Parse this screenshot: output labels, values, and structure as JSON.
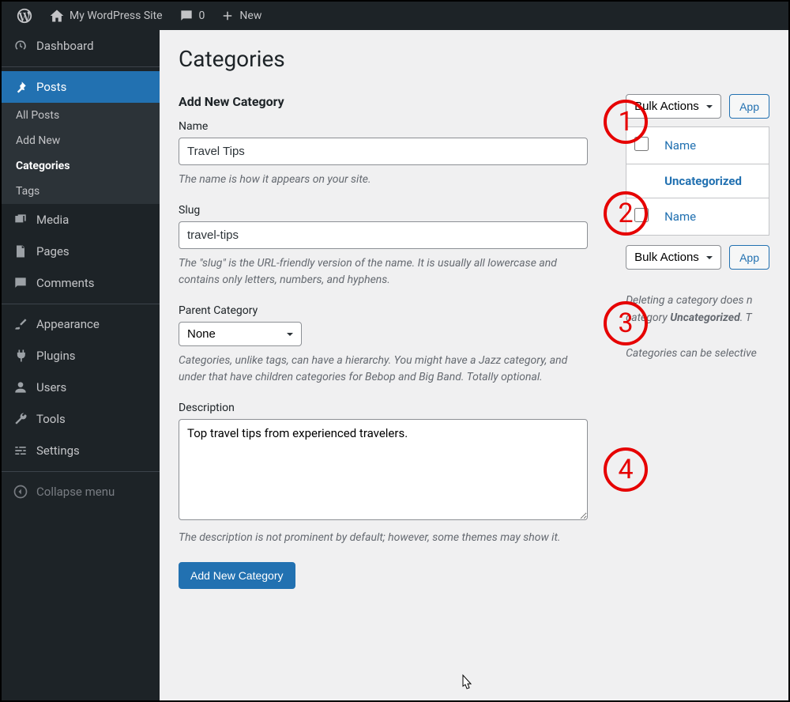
{
  "toolbar": {
    "site_name": "My WordPress Site",
    "comment_count": "0",
    "new_label": "New"
  },
  "sidebar": {
    "dashboard": "Dashboard",
    "posts": "Posts",
    "posts_sub": {
      "all": "All Posts",
      "add": "Add New",
      "categories": "Categories",
      "tags": "Tags"
    },
    "media": "Media",
    "pages": "Pages",
    "comments": "Comments",
    "appearance": "Appearance",
    "plugins": "Plugins",
    "users": "Users",
    "tools": "Tools",
    "settings": "Settings",
    "collapse": "Collapse menu"
  },
  "page": {
    "h1": "Categories",
    "form_title": "Add New Category",
    "name_label": "Name",
    "name_value": "Travel Tips",
    "name_help": "The name is how it appears on your site.",
    "slug_label": "Slug",
    "slug_value": "travel-tips",
    "slug_help": "The \"slug\" is the URL-friendly version of the name. It is usually all lowercase and contains only letters, numbers, and hyphens.",
    "parent_label": "Parent Category",
    "parent_value": "None",
    "parent_help": "Categories, unlike tags, can have a hierarchy. You might have a Jazz category, and under that have children categories for Bebop and Big Band. Totally optional.",
    "desc_label": "Description",
    "desc_value": "Top travel tips from experienced travelers.",
    "desc_help": "The description is not prominent by default; however, some themes may show it.",
    "submit": "Add New Category"
  },
  "list": {
    "bulk_label": "Bulk Actions",
    "apply": "App",
    "col_name": "Name",
    "row1": "Uncategorized",
    "note_line1_a": "Deleting a category does n",
    "note_line1_b": "category ",
    "note_line1_strong": "Uncategorized",
    "note_line1_c": ". T",
    "note_line2": "Categories can be selective"
  },
  "annotations": {
    "a1": "1",
    "a2": "2",
    "a3": "3",
    "a4": "4"
  }
}
